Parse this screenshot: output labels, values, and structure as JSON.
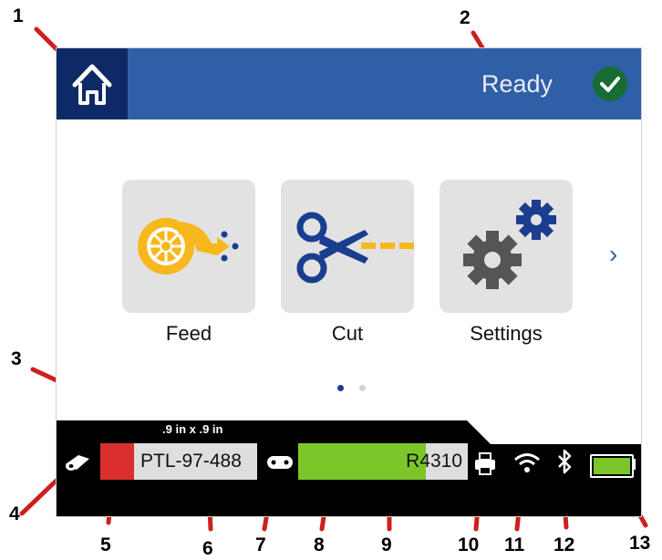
{
  "header": {
    "status_text": "Ready",
    "home_icon": "home-icon",
    "status_icon": "checkmark-circle-icon"
  },
  "tiles": [
    {
      "label": "Feed",
      "icon": "feed-roll-icon"
    },
    {
      "label": "Cut",
      "icon": "scissors-icon"
    },
    {
      "label": "Settings",
      "icon": "gears-icon"
    }
  ],
  "pagination": {
    "pages": 2,
    "current": 1
  },
  "status_bar": {
    "label_size": ".9 in x .9 in",
    "label_part": "PTL-97-488",
    "label_color": "#d9302e",
    "ribbon_part": "R4310",
    "ribbon_level": 0.75,
    "battery_level": 1.0
  },
  "colors": {
    "header_blue": "#2f5fa6",
    "home_navy": "#0e2a66",
    "ready_green": "#176c33",
    "level_green": "#7cc62a",
    "icon_yellow": "#f6b81d",
    "icon_navy": "#1a3d8f",
    "callout_red": "#cc1f1f"
  },
  "callouts": [
    "1",
    "2",
    "3",
    "4",
    "5",
    "6",
    "7",
    "8",
    "9",
    "10",
    "11",
    "12",
    "13"
  ]
}
